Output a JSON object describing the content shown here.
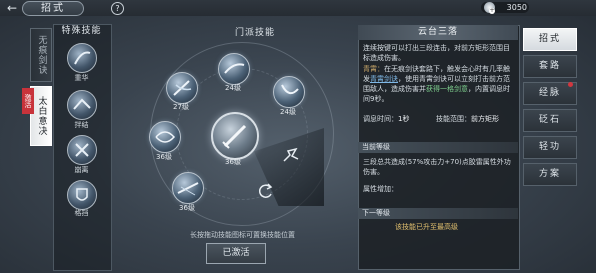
{
  "header": {
    "title": "招式",
    "help": "?",
    "currency": "3050"
  },
  "left_tabs": [
    {
      "label": "无痕剑诀",
      "selected": false
    },
    {
      "label": "太白意决",
      "selected": true,
      "tag": "激活"
    }
  ],
  "special_skills": {
    "title": "特殊技能",
    "items": [
      {
        "label": "重华"
      },
      {
        "label": "拌结"
      },
      {
        "label": "崩离"
      },
      {
        "label": "格挡"
      }
    ]
  },
  "ring": {
    "title": "门派技能",
    "skills": [
      {
        "level": "24级"
      },
      {
        "level": "27级"
      },
      {
        "level": "24级"
      },
      {
        "level": "36级"
      },
      {
        "level": "36级"
      },
      {
        "level": "36级"
      }
    ],
    "hint": "长按拖动技能图标可置换技能位置",
    "button": "已激活"
  },
  "info": {
    "title": "云台三落",
    "desc_1": "连续按键可以打出三段连击，对前方矩形范围目标造成伤害。",
    "desc_2_key": "青霄：",
    "desc_2": "在无痕剑诀套路下，触发会心时有几率触发",
    "desc_2_link": "青霄剑诀",
    "desc_2b": "，使用青霄剑诀可以立刻打击前方范围敌人，造成伤害并",
    "desc_2_green": "获得一格剑意",
    "desc_2c": "，内置调息时间9秒。",
    "cooldown_label": "调息时间：",
    "cooldown": "1秒",
    "range_label": "技能范围：",
    "range": "前方矩形",
    "cur_level_title": "当前等级",
    "cur_level_text": "三段总共造成(57%攻击力+70)点胶雷属性外功伤害。",
    "attr_label": "属性增加：",
    "next_level_title": "下一等级",
    "next_level_text": "该技能已升至最高级"
  },
  "right_nav": [
    "招式",
    "套路",
    "经脉",
    "砭石",
    "轻功",
    "方案"
  ]
}
